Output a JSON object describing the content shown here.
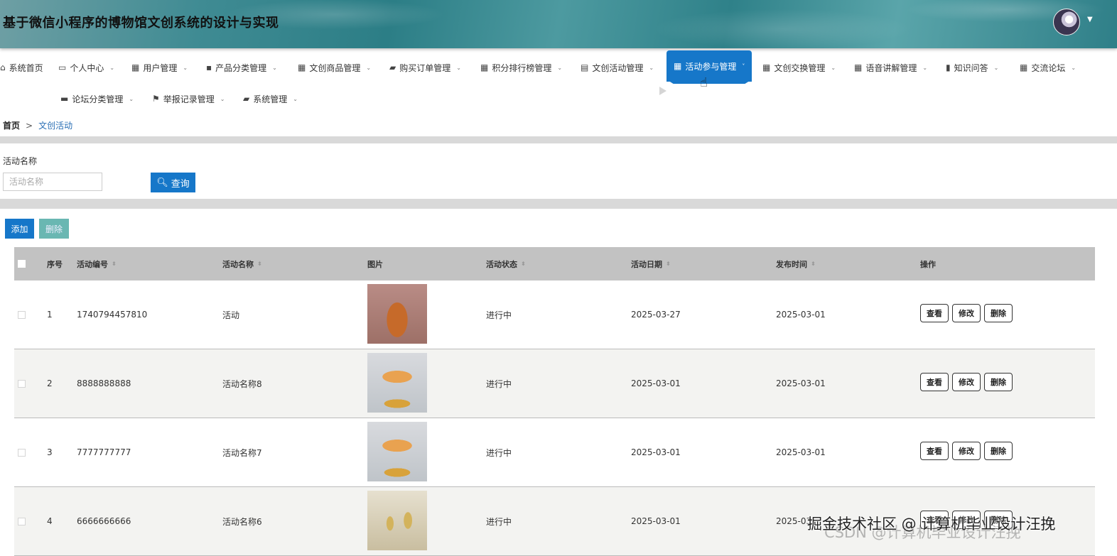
{
  "header": {
    "title": "基于微信小程序的博物馆文创系统的设计与实现"
  },
  "nav": {
    "items": [
      {
        "label": "系统首页",
        "icon": "home-icon"
      },
      {
        "label": "个人中心",
        "icon": "card-icon"
      },
      {
        "label": "用户管理",
        "icon": "grid-icon"
      },
      {
        "label": "产品分类管理",
        "icon": "message-icon"
      },
      {
        "label": "文创商品管理",
        "icon": "grid-icon"
      },
      {
        "label": "购买订单管理",
        "icon": "bag-icon"
      },
      {
        "label": "积分排行榜管理",
        "icon": "grid-icon"
      },
      {
        "label": "文创活动管理",
        "icon": "clipboard-icon"
      },
      {
        "label": "活动参与管理",
        "icon": "grid-icon"
      },
      {
        "label": "文创交换管理",
        "icon": "table-icon"
      },
      {
        "label": "语音讲解管理",
        "icon": "table-icon"
      },
      {
        "label": "知识问答",
        "icon": "chart-icon"
      },
      {
        "label": "交流论坛",
        "icon": "grid-icon"
      },
      {
        "label": "论坛分类管理",
        "icon": "monitor-icon"
      },
      {
        "label": "举报记录管理",
        "icon": "flag-icon"
      },
      {
        "label": "系统管理",
        "icon": "case-icon"
      }
    ],
    "active_index": 8
  },
  "breadcrumb": {
    "home": "首页",
    "separator": ">",
    "current": "文创活动"
  },
  "search": {
    "label": "活动名称",
    "placeholder": "活动名称",
    "button": "查询"
  },
  "toolbar": {
    "add": "添加",
    "delete": "删除"
  },
  "table": {
    "columns": [
      "序号",
      "活动编号",
      "活动名称",
      "图片",
      "活动状态",
      "活动日期",
      "发布时间",
      "操作"
    ],
    "rows": [
      {
        "index": "1",
        "code": "1740794457810",
        "name": "活动",
        "image": "vase",
        "status": "进行中",
        "date": "2025-03-27",
        "published": "2025-03-01"
      },
      {
        "index": "2",
        "code": "8888888888",
        "name": "活动名称8",
        "image": "horse",
        "status": "进行中",
        "date": "2025-03-01",
        "published": "2025-03-01"
      },
      {
        "index": "3",
        "code": "7777777777",
        "name": "活动名称7",
        "image": "horse",
        "status": "进行中",
        "date": "2025-03-01",
        "published": "2025-03-01"
      },
      {
        "index": "4",
        "code": "6666666666",
        "name": "活动名称6",
        "image": "cage",
        "status": "进行中",
        "date": "2025-03-01",
        "published": "2025-03"
      }
    ],
    "actions": {
      "view": "查看",
      "edit": "修改",
      "delete": "删除"
    }
  },
  "watermark": {
    "text": "掘金技术社区 @ 计算机毕业设计汪挽",
    "shadow": "CSDN @计算机毕业设计汪挽"
  },
  "colors": {
    "primary": "#1677c9",
    "delete_btn": "#6ab7b2",
    "header_bg": "#2c7e86",
    "table_header": "#c2c2c2"
  }
}
